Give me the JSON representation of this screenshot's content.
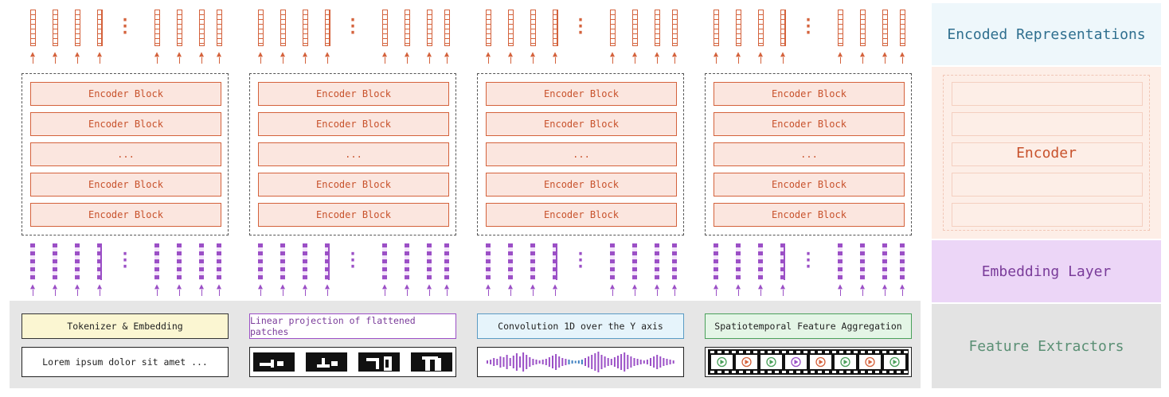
{
  "columns": [
    {
      "id": "text",
      "feature_extractor": "Tokenizer & Embedding",
      "input_text": "Lorem ipsum dolor sit amet ...",
      "input_type": "text"
    },
    {
      "id": "image",
      "feature_extractor": "Linear projection of flattened patches",
      "input_text": "",
      "input_type": "image-patches"
    },
    {
      "id": "audio",
      "feature_extractor": "Convolution 1D over the Y axis",
      "input_text": "",
      "input_type": "waveform"
    },
    {
      "id": "video",
      "feature_extractor": "Spatiotemporal Feature Aggregation",
      "input_text": "",
      "input_type": "video-frames"
    }
  ],
  "encoder_blocks": [
    "Encoder Block",
    "Encoder Block",
    "...",
    "Encoder Block",
    "Encoder Block"
  ],
  "legend": {
    "encoded": "Encoded Representations",
    "encoder": "Encoder",
    "embedding": "Embedding Layer",
    "feature": "Feature Extractors"
  },
  "colors": {
    "encoded_text": "#2f6f8f",
    "encoded_bg": "#eef7fb",
    "encoder_text": "#c8522c",
    "encoder_bg": "#fdeee7",
    "embedding_text": "#7a3c9a",
    "embedding_bg": "#ecd6f7",
    "feature_text": "#5a8f74",
    "feature_bg": "#e3e3e3",
    "fe_text_bg": "#fbf6d2",
    "fe_text_border": "#333333",
    "fe_image_bg": "#ffffff",
    "fe_image_border": "#9b4fc6",
    "fe_audio_bg": "#e6f4fb",
    "fe_audio_border": "#5a9bc4",
    "fe_video_bg": "#e4f5e6",
    "fe_video_border": "#4aa05a",
    "token_out": "#d4623c",
    "token_emb": "#9b4fc6"
  }
}
